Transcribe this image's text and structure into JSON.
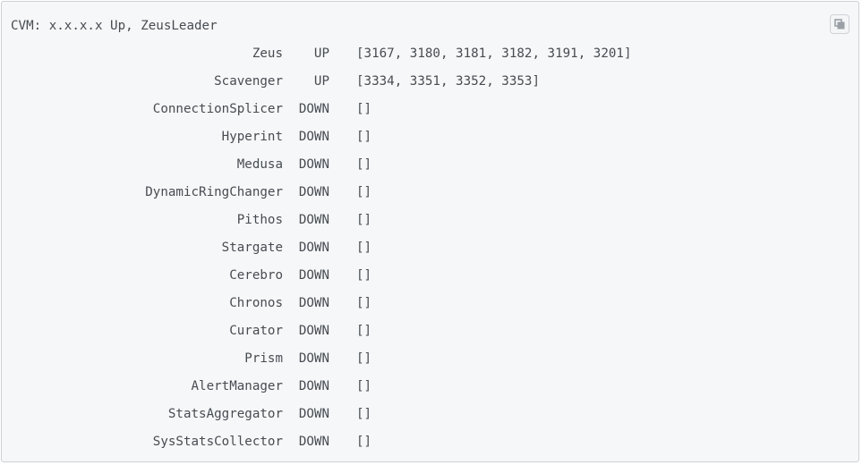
{
  "header": "CVM: x.x.x.x Up, ZeusLeader",
  "copy_button": {
    "icon": "copy-icon"
  },
  "services": [
    {
      "name": "Zeus",
      "status": "UP",
      "pids": "[3167, 3180, 3181, 3182, 3191, 3201]"
    },
    {
      "name": "Scavenger",
      "status": "UP",
      "pids": "[3334, 3351, 3352, 3353]"
    },
    {
      "name": "ConnectionSplicer",
      "status": "DOWN",
      "pids": "[]"
    },
    {
      "name": "Hyperint",
      "status": "DOWN",
      "pids": "[]"
    },
    {
      "name": "Medusa",
      "status": "DOWN",
      "pids": "[]"
    },
    {
      "name": "DynamicRingChanger",
      "status": "DOWN",
      "pids": "[]"
    },
    {
      "name": "Pithos",
      "status": "DOWN",
      "pids": "[]"
    },
    {
      "name": "Stargate",
      "status": "DOWN",
      "pids": "[]"
    },
    {
      "name": "Cerebro",
      "status": "DOWN",
      "pids": "[]"
    },
    {
      "name": "Chronos",
      "status": "DOWN",
      "pids": "[]"
    },
    {
      "name": "Curator",
      "status": "DOWN",
      "pids": "[]"
    },
    {
      "name": "Prism",
      "status": "DOWN",
      "pids": "[]"
    },
    {
      "name": "AlertManager",
      "status": "DOWN",
      "pids": "[]"
    },
    {
      "name": "StatsAggregator",
      "status": "DOWN",
      "pids": "[]"
    },
    {
      "name": "SysStatsCollector",
      "status": "DOWN",
      "pids": "[]"
    }
  ]
}
